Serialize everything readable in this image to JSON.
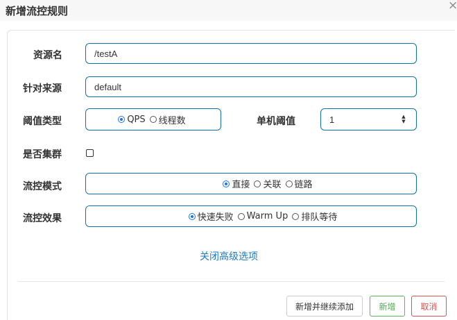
{
  "dialog": {
    "title": "新增流控规则",
    "close_glyph": "×"
  },
  "form": {
    "resource": {
      "label": "资源名",
      "value": "/testA"
    },
    "origin": {
      "label": "针对来源",
      "value": "default"
    },
    "threshold_type": {
      "label": "阈值类型",
      "options": [
        "QPS",
        "线程数"
      ],
      "selected": "QPS"
    },
    "single_threshold": {
      "label": "单机阈值",
      "value": "1"
    },
    "cluster": {
      "label": "是否集群",
      "checked": false
    },
    "control_mode": {
      "label": "流控模式",
      "options": [
        "直接",
        "关联",
        "链路"
      ],
      "selected": "直接"
    },
    "control_effect": {
      "label": "流控效果",
      "options": [
        "快速失败",
        "Warm Up",
        "排队等待"
      ],
      "selected": "快速失败"
    },
    "advanced_link": "关闭高级选项"
  },
  "footer": {
    "continue_label": "新增并继续添加",
    "add_label": "新增",
    "cancel_label": "取消"
  },
  "colors": {
    "input_border": "#0b72ab",
    "radio_checked": "#1a73e8",
    "add_button": "#5cb85c",
    "cancel_button": "#d9534f",
    "link": "#1f7ac3"
  }
}
